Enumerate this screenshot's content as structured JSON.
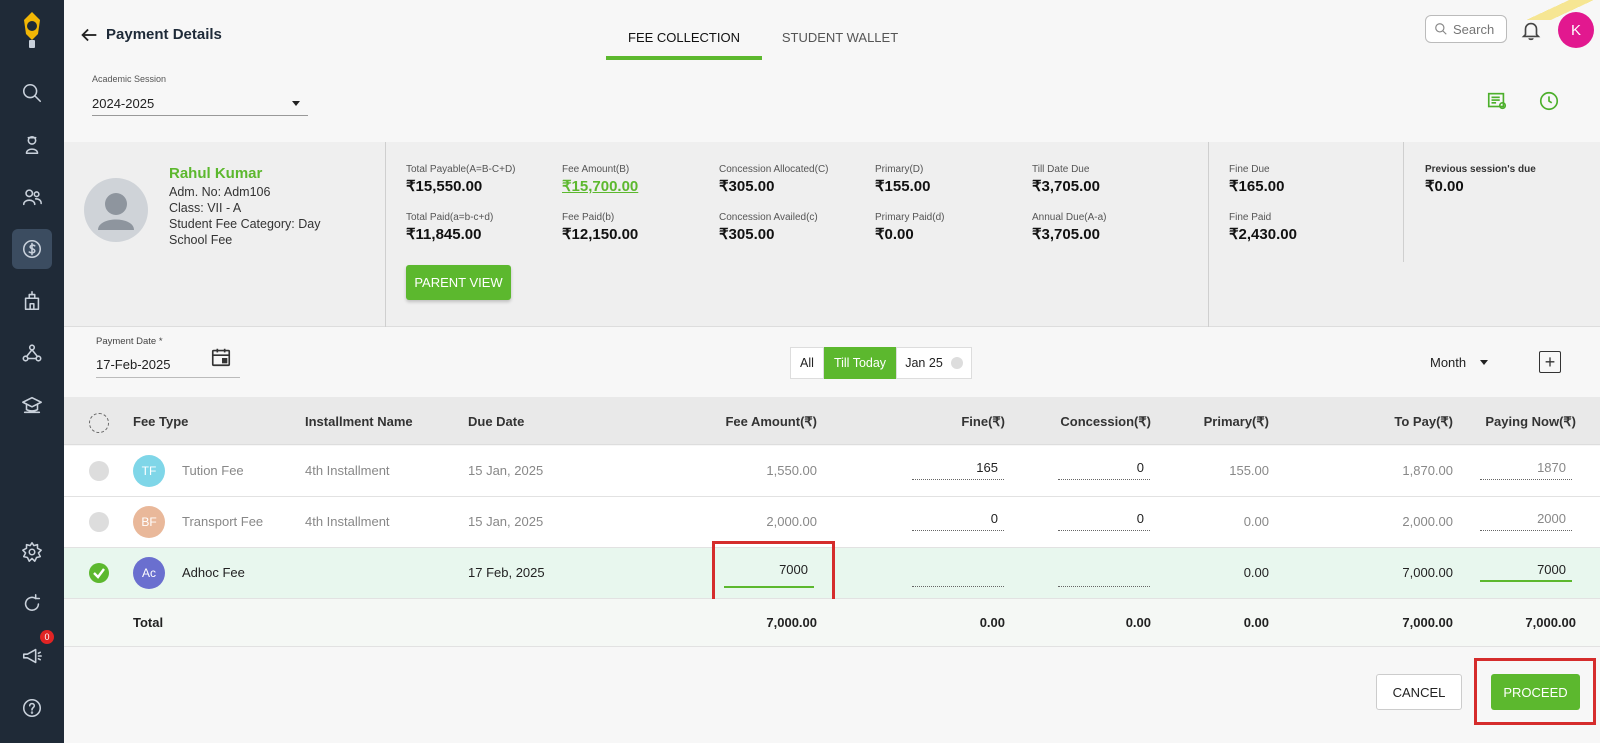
{
  "header": {
    "title": "Payment Details",
    "tabs": [
      "FEE COLLECTION",
      "STUDENT WALLET"
    ],
    "active_tab": "FEE COLLECTION",
    "search_placeholder": "Search",
    "user_initial": "K"
  },
  "session": {
    "label": "Academic Session",
    "value": "2024-2025"
  },
  "student": {
    "name": "Rahul Kumar",
    "adm_no": "Adm. No: Adm106",
    "class": "Class: VII - A",
    "category_line1": "Student Fee Category: Day",
    "category_line2": "School Fee"
  },
  "stats": {
    "total_payable_label": "Total Payable(A=B-C+D)",
    "total_payable": "₹15,550.00",
    "fee_amount_label": "Fee Amount(B)",
    "fee_amount": "₹15,700.00",
    "concession_allocated_label": "Concession Allocated(C)",
    "concession_allocated": "₹305.00",
    "primary_label": "Primary(D)",
    "primary": "₹155.00",
    "till_date_due_label": "Till Date Due",
    "till_date_due": "₹3,705.00",
    "total_paid_label": "Total Paid(a=b-c+d)",
    "total_paid": "₹11,845.00",
    "fee_paid_label": "Fee Paid(b)",
    "fee_paid": "₹12,150.00",
    "concession_availed_label": "Concession Availed(c)",
    "concession_availed": "₹305.00",
    "primary_paid_label": "Primary Paid(d)",
    "primary_paid": "₹0.00",
    "annual_due_label": "Annual Due(A-a)",
    "annual_due": "₹3,705.00",
    "fine_due_label": "Fine Due",
    "fine_due": "₹165.00",
    "fine_paid_label": "Fine Paid",
    "fine_paid": "₹2,430.00",
    "prev_due_label": "Previous session's due",
    "prev_due": "₹0.00"
  },
  "parent_view_label": "PARENT VIEW",
  "payment_date": {
    "label": "Payment Date *",
    "value": "17-Feb-2025"
  },
  "filters": [
    "All",
    "Till Today",
    "Jan 25"
  ],
  "active_filter": "Till Today",
  "period_select": "Month",
  "columns": [
    "Fee Type",
    "Installment Name",
    "Due Date",
    "Fee Amount(₹)",
    "Fine(₹)",
    "Concession(₹)",
    "Primary(₹)",
    "To Pay(₹)",
    "Paying Now(₹)"
  ],
  "rows": [
    {
      "initials": "TF",
      "color": "#7fd6e8",
      "fee_type": "Tution Fee",
      "installment": "4th Installment",
      "due": "15 Jan, 2025",
      "amount": "1,550.00",
      "fine": "165",
      "concession": "0",
      "primary": "155.00",
      "to_pay": "1,870.00",
      "paying_now": "1870"
    },
    {
      "initials": "BF",
      "color": "#e9b89a",
      "fee_type": "Transport Fee",
      "installment": "4th Installment",
      "due": "15 Jan, 2025",
      "amount": "2,000.00",
      "fine": "0",
      "concession": "0",
      "primary": "0.00",
      "to_pay": "2,000.00",
      "paying_now": "2000"
    },
    {
      "initials": "Ac",
      "color": "#6a6fcf",
      "fee_type": "Adhoc Fee",
      "installment": "",
      "due": "17 Feb, 2025",
      "amount": "7000",
      "fine": "",
      "concession": "",
      "primary": "0.00",
      "to_pay": "7,000.00",
      "paying_now": "7000"
    }
  ],
  "total": {
    "label": "Total",
    "amount": "7,000.00",
    "fine": "0.00",
    "concession": "0.00",
    "primary": "0.00",
    "to_pay": "7,000.00",
    "paying_now": "7,000.00"
  },
  "buttons": {
    "cancel": "CANCEL",
    "proceed": "PROCEED"
  },
  "notification_count": "0"
}
